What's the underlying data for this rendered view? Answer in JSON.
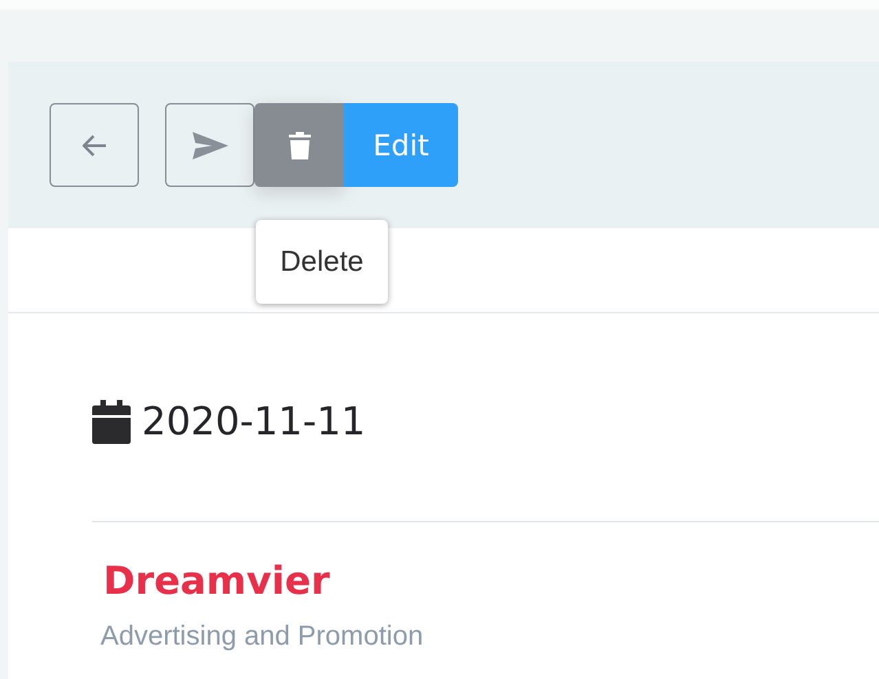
{
  "toolbar": {
    "buttons": [
      {
        "kind": "back"
      },
      {
        "kind": "send"
      },
      {
        "kind": "delete",
        "tooltip": "Delete"
      },
      {
        "kind": "edit",
        "label": "Edit"
      }
    ]
  },
  "event": {
    "date": "2020-11-11",
    "company": "Dreamvier",
    "category": "Advertising and Promotion"
  }
}
